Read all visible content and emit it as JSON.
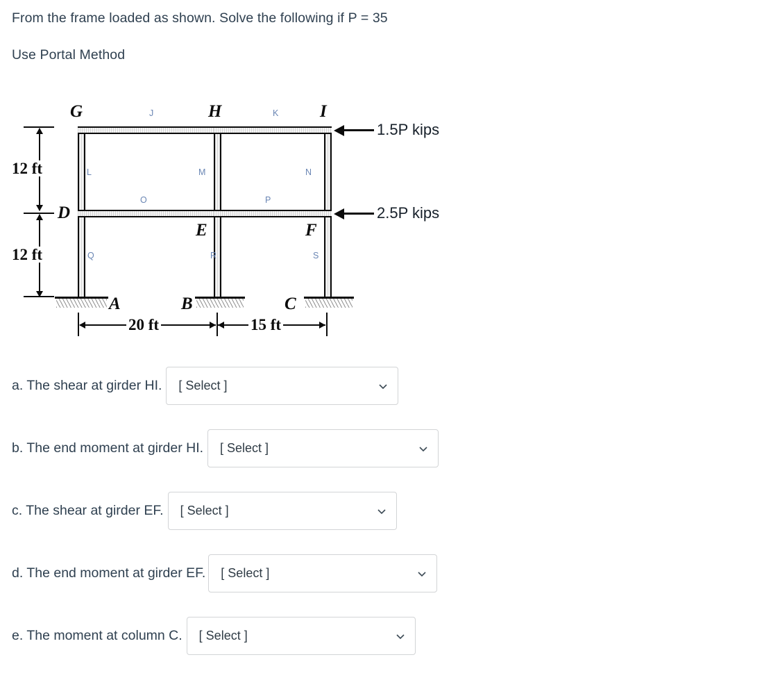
{
  "prompt": {
    "line1": "From the frame loaded as shown. Solve the following if P = 35",
    "line2": "Use Portal Method"
  },
  "figure": {
    "joint_labels": [
      {
        "id": "G",
        "text": "G"
      },
      {
        "id": "H",
        "text": "H"
      },
      {
        "id": "I",
        "text": "I"
      },
      {
        "id": "D",
        "text": "D"
      },
      {
        "id": "E",
        "text": "E"
      },
      {
        "id": "F",
        "text": "F"
      },
      {
        "id": "A",
        "text": "A"
      },
      {
        "id": "B",
        "text": "B"
      },
      {
        "id": "C",
        "text": "C"
      }
    ],
    "midpoint_labels": [
      {
        "id": "J",
        "text": "J"
      },
      {
        "id": "K",
        "text": "K"
      },
      {
        "id": "L",
        "text": "L"
      },
      {
        "id": "M",
        "text": "M"
      },
      {
        "id": "N",
        "text": "N"
      },
      {
        "id": "O",
        "text": "O"
      },
      {
        "id": "P",
        "text": "P"
      },
      {
        "id": "Q",
        "text": "Q"
      },
      {
        "id": "R",
        "text": "R"
      },
      {
        "id": "S",
        "text": "S"
      }
    ],
    "loads": [
      {
        "id": "top",
        "text": "1.5P kips"
      },
      {
        "id": "middle",
        "text": "2.5P kips"
      }
    ],
    "dimensions": {
      "story_upper": "12 ft",
      "story_lower": "12 ft",
      "bay_left": "20 ft",
      "bay_right": "15 ft"
    },
    "label_color": "#6a86b4"
  },
  "questions": [
    {
      "label": "a. The shear at girder HI.",
      "value": "[ Select ]"
    },
    {
      "label": "b. The end moment at girder HI.",
      "value": "[ Select ]"
    },
    {
      "label": "c. The shear at girder EF.",
      "value": "[ Select ]"
    },
    {
      "label": "d. The end moment at girder EF.",
      "value": "[ Select ]"
    },
    {
      "label": "e. The moment at column C.",
      "value": "[ Select ]"
    }
  ]
}
